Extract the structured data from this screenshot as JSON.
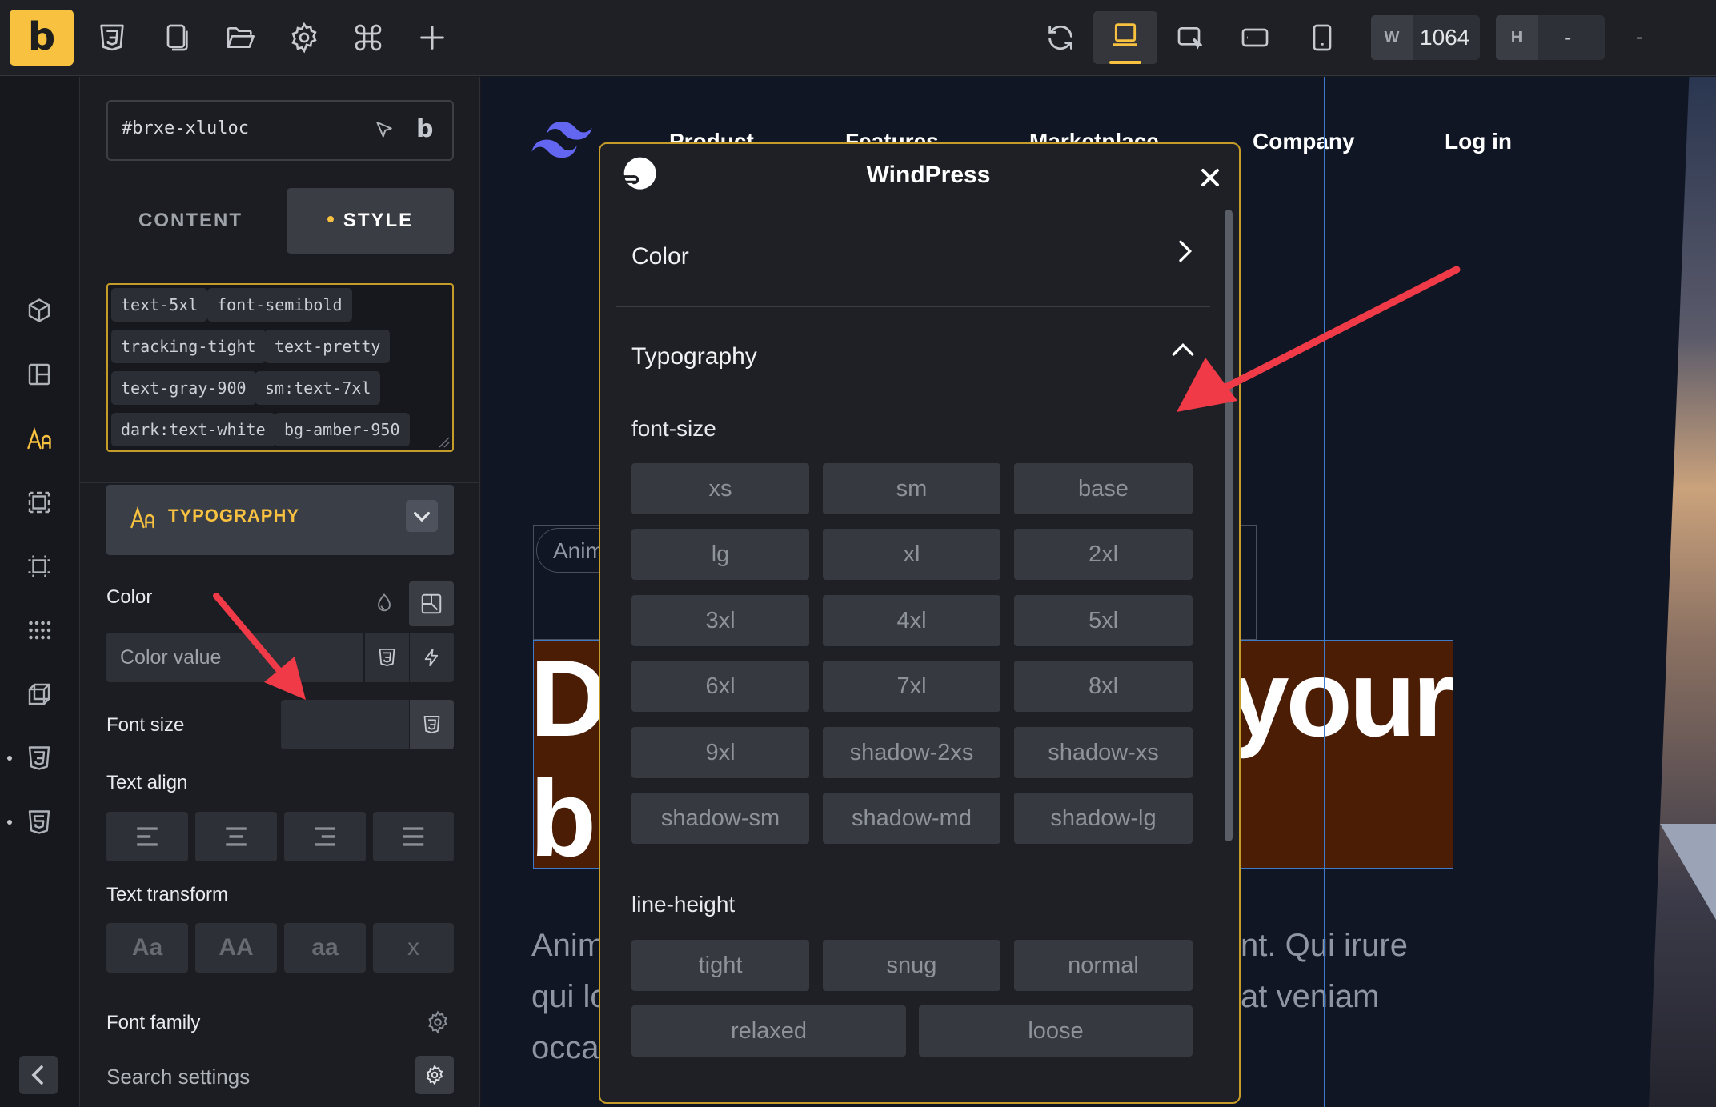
{
  "toolbar": {
    "logo": "b",
    "width_label": "W",
    "width_value": "1064",
    "height_label": "H",
    "height_value": "-",
    "extra_value": "-"
  },
  "panel": {
    "selector": "#brxe-xluloc",
    "tabs": {
      "content": "CONTENT",
      "style": "STYLE"
    },
    "classes": [
      "text-5xl",
      "font-semibold",
      "tracking-tight",
      "text-pretty",
      "text-gray-900",
      "sm:text-7xl",
      "dark:text-white",
      "bg-amber-950"
    ],
    "section_title": "TYPOGRAPHY",
    "color_label": "Color",
    "color_placeholder": "Color value",
    "font_size_label": "Font size",
    "text_align_label": "Text align",
    "text_transform_label": "Text transform",
    "text_transform_options": [
      "Aa",
      "AA",
      "aa",
      "x"
    ],
    "font_family_label": "Font family",
    "search_placeholder": "Search settings"
  },
  "canvas": {
    "nav": [
      "Product",
      "Features",
      "Marketplace",
      "Company",
      "Log in"
    ],
    "badge": "Anim",
    "hero_left_1": "D",
    "hero_right_1": "your",
    "hero_left_2": "b",
    "para_lines_left": [
      "Anim",
      "qui lo",
      "occa"
    ],
    "para_lines_right": [
      "nt. Qui irure",
      "at veniam"
    ]
  },
  "modal": {
    "title": "WindPress",
    "color_section": "Color",
    "typography_section": "Typography",
    "font_size_label": "font-size",
    "font_sizes": [
      "xs",
      "sm",
      "base",
      "lg",
      "xl",
      "2xl",
      "3xl",
      "4xl",
      "5xl",
      "6xl",
      "7xl",
      "8xl",
      "9xl",
      "shadow-2xs",
      "shadow-xs",
      "shadow-sm",
      "shadow-md",
      "shadow-lg"
    ],
    "line_height_label": "line-height",
    "line_heights": [
      "tight",
      "snug",
      "normal",
      "relaxed",
      "loose"
    ]
  },
  "colors": {
    "accent": "#f8c140",
    "annotation_arrow": "#f03a47",
    "selection_outline": "#3e7ccb",
    "hero_bg": "#4a1d04"
  }
}
